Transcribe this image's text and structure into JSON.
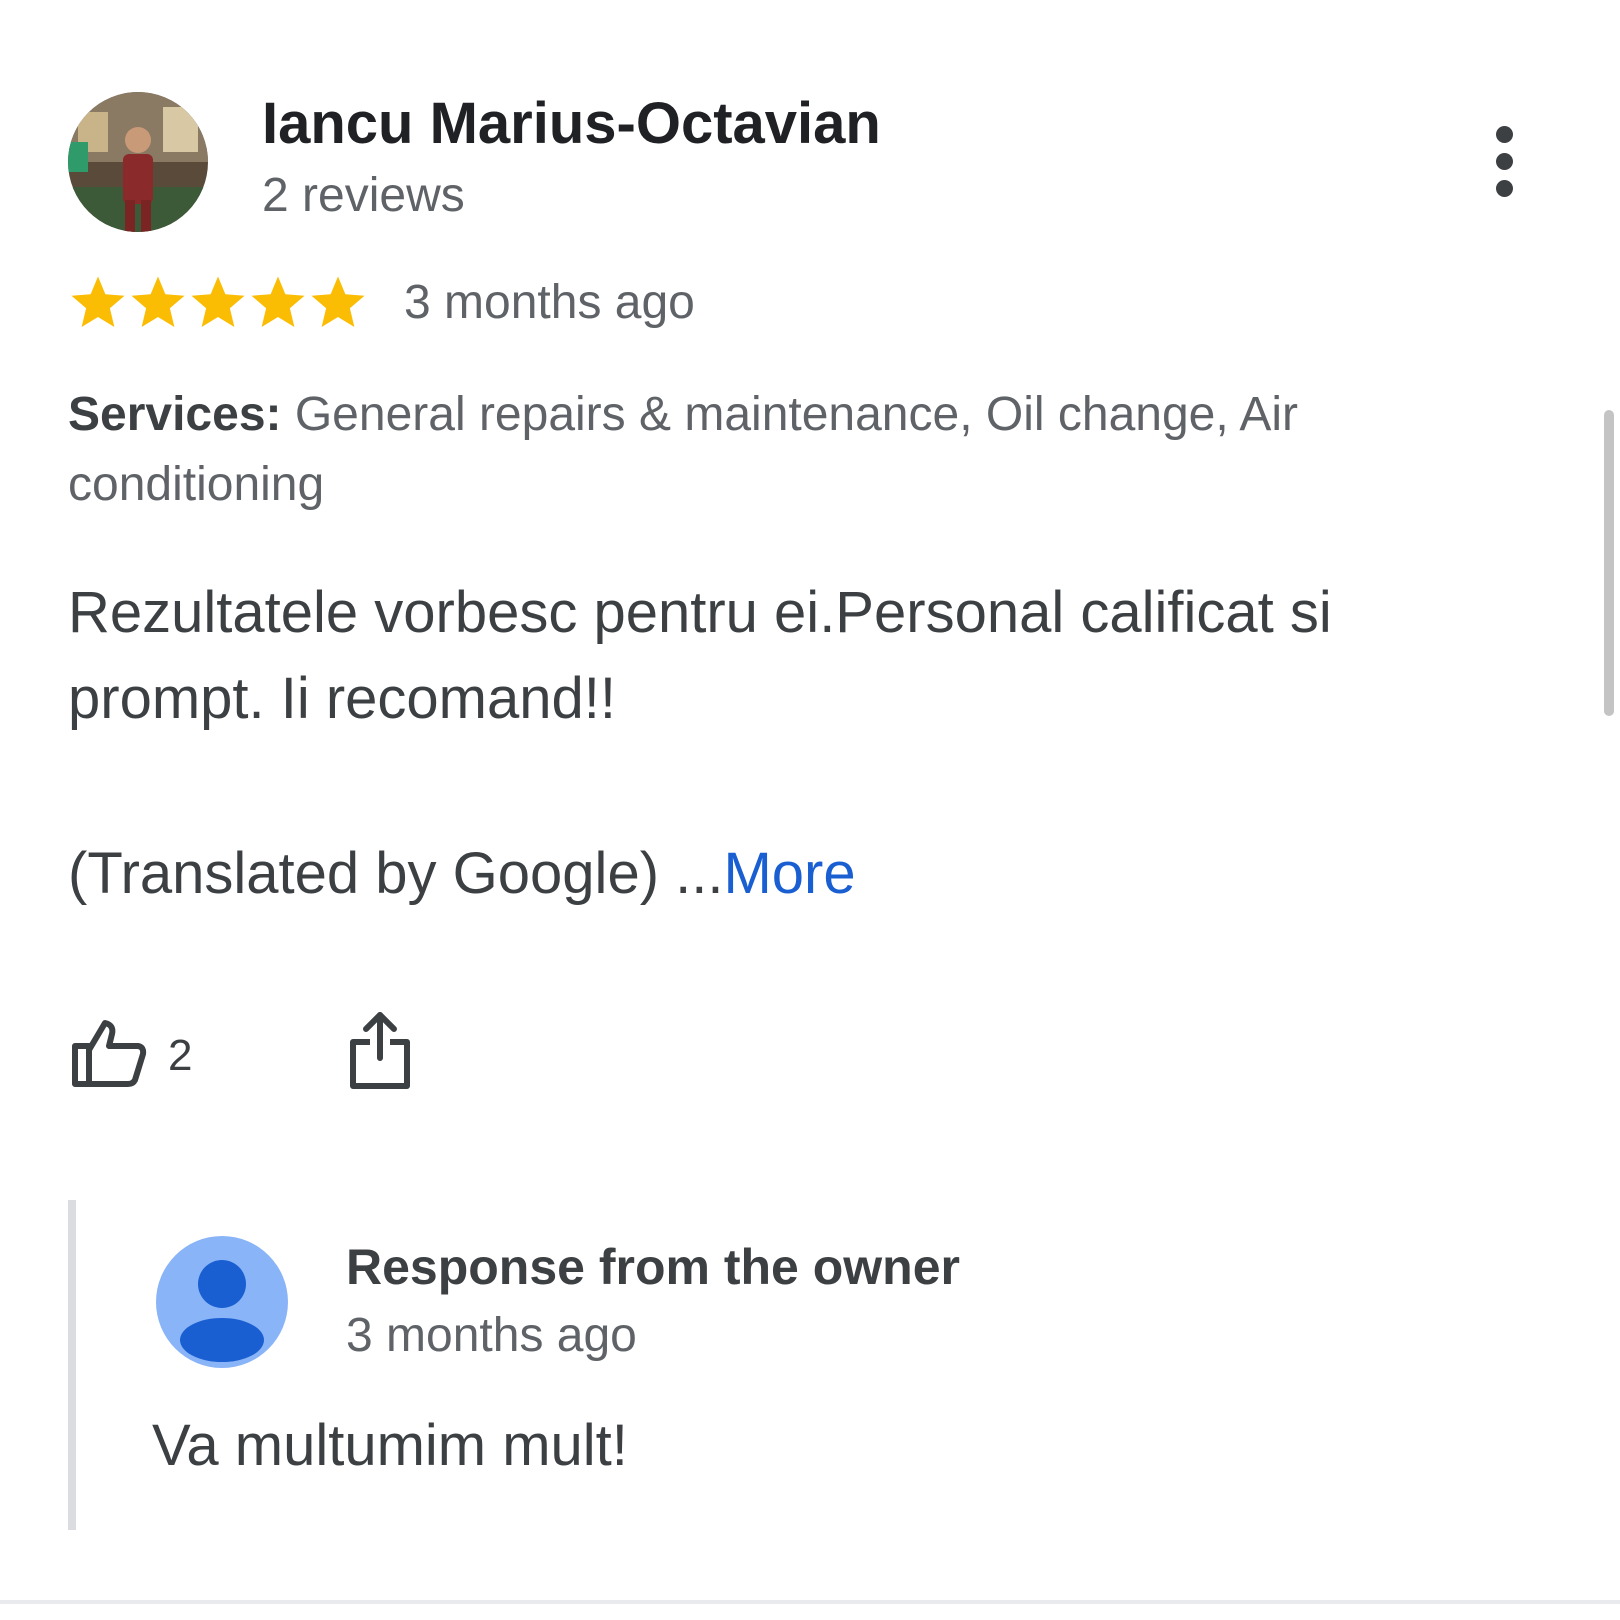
{
  "review": {
    "reviewer_name": "Iancu Marius-Octavian",
    "reviewer_reviews": "2 reviews",
    "rating": 5,
    "rating_max": 5,
    "star_color": "#fbbc04",
    "time_ago": "3 months ago",
    "services_label": "Services:",
    "services_value": " General repairs & maintenance, Oil change, Air conditioning",
    "text": "Rezultatele vorbesc pentru ei.Personal calificat si prompt. Ii recomand!!",
    "translated_prefix": "(Translated by Google) ...",
    "more_label": "More",
    "more_color": "#1a5fd1",
    "like_icon": "thumbs-up-icon",
    "like_count": "2",
    "share_icon": "share-icon",
    "menu_icon": "more-vert-icon"
  },
  "owner_response": {
    "title": "Response from the owner",
    "time_ago": "3 months ago",
    "text": "Va multumim mult!",
    "avatar_icon": "person-icon",
    "avatar_color": "#8ab4f8"
  }
}
